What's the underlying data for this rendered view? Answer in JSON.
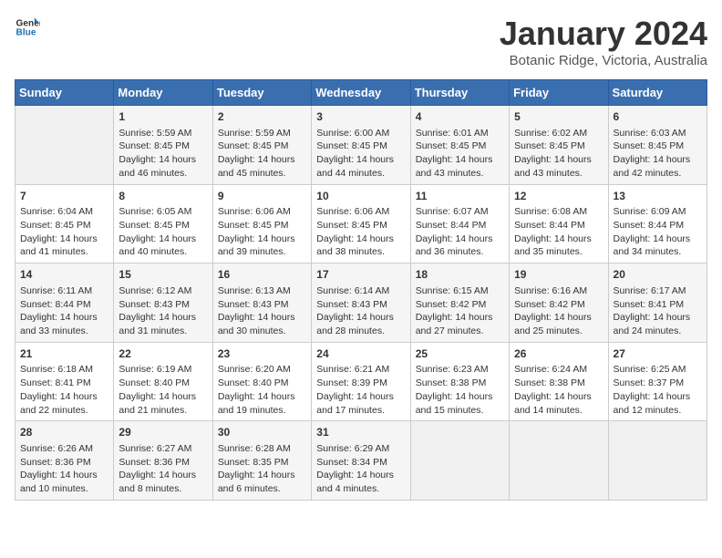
{
  "logo": {
    "line1": "General",
    "line2": "Blue"
  },
  "title": "January 2024",
  "subtitle": "Botanic Ridge, Victoria, Australia",
  "days_of_week": [
    "Sunday",
    "Monday",
    "Tuesday",
    "Wednesday",
    "Thursday",
    "Friday",
    "Saturday"
  ],
  "weeks": [
    [
      {
        "day": "",
        "info": ""
      },
      {
        "day": "1",
        "info": "Sunrise: 5:59 AM\nSunset: 8:45 PM\nDaylight: 14 hours\nand 46 minutes."
      },
      {
        "day": "2",
        "info": "Sunrise: 5:59 AM\nSunset: 8:45 PM\nDaylight: 14 hours\nand 45 minutes."
      },
      {
        "day": "3",
        "info": "Sunrise: 6:00 AM\nSunset: 8:45 PM\nDaylight: 14 hours\nand 44 minutes."
      },
      {
        "day": "4",
        "info": "Sunrise: 6:01 AM\nSunset: 8:45 PM\nDaylight: 14 hours\nand 43 minutes."
      },
      {
        "day": "5",
        "info": "Sunrise: 6:02 AM\nSunset: 8:45 PM\nDaylight: 14 hours\nand 43 minutes."
      },
      {
        "day": "6",
        "info": "Sunrise: 6:03 AM\nSunset: 8:45 PM\nDaylight: 14 hours\nand 42 minutes."
      }
    ],
    [
      {
        "day": "7",
        "info": "Sunrise: 6:04 AM\nSunset: 8:45 PM\nDaylight: 14 hours\nand 41 minutes."
      },
      {
        "day": "8",
        "info": "Sunrise: 6:05 AM\nSunset: 8:45 PM\nDaylight: 14 hours\nand 40 minutes."
      },
      {
        "day": "9",
        "info": "Sunrise: 6:06 AM\nSunset: 8:45 PM\nDaylight: 14 hours\nand 39 minutes."
      },
      {
        "day": "10",
        "info": "Sunrise: 6:06 AM\nSunset: 8:45 PM\nDaylight: 14 hours\nand 38 minutes."
      },
      {
        "day": "11",
        "info": "Sunrise: 6:07 AM\nSunset: 8:44 PM\nDaylight: 14 hours\nand 36 minutes."
      },
      {
        "day": "12",
        "info": "Sunrise: 6:08 AM\nSunset: 8:44 PM\nDaylight: 14 hours\nand 35 minutes."
      },
      {
        "day": "13",
        "info": "Sunrise: 6:09 AM\nSunset: 8:44 PM\nDaylight: 14 hours\nand 34 minutes."
      }
    ],
    [
      {
        "day": "14",
        "info": "Sunrise: 6:11 AM\nSunset: 8:44 PM\nDaylight: 14 hours\nand 33 minutes."
      },
      {
        "day": "15",
        "info": "Sunrise: 6:12 AM\nSunset: 8:43 PM\nDaylight: 14 hours\nand 31 minutes."
      },
      {
        "day": "16",
        "info": "Sunrise: 6:13 AM\nSunset: 8:43 PM\nDaylight: 14 hours\nand 30 minutes."
      },
      {
        "day": "17",
        "info": "Sunrise: 6:14 AM\nSunset: 8:43 PM\nDaylight: 14 hours\nand 28 minutes."
      },
      {
        "day": "18",
        "info": "Sunrise: 6:15 AM\nSunset: 8:42 PM\nDaylight: 14 hours\nand 27 minutes."
      },
      {
        "day": "19",
        "info": "Sunrise: 6:16 AM\nSunset: 8:42 PM\nDaylight: 14 hours\nand 25 minutes."
      },
      {
        "day": "20",
        "info": "Sunrise: 6:17 AM\nSunset: 8:41 PM\nDaylight: 14 hours\nand 24 minutes."
      }
    ],
    [
      {
        "day": "21",
        "info": "Sunrise: 6:18 AM\nSunset: 8:41 PM\nDaylight: 14 hours\nand 22 minutes."
      },
      {
        "day": "22",
        "info": "Sunrise: 6:19 AM\nSunset: 8:40 PM\nDaylight: 14 hours\nand 21 minutes."
      },
      {
        "day": "23",
        "info": "Sunrise: 6:20 AM\nSunset: 8:40 PM\nDaylight: 14 hours\nand 19 minutes."
      },
      {
        "day": "24",
        "info": "Sunrise: 6:21 AM\nSunset: 8:39 PM\nDaylight: 14 hours\nand 17 minutes."
      },
      {
        "day": "25",
        "info": "Sunrise: 6:23 AM\nSunset: 8:38 PM\nDaylight: 14 hours\nand 15 minutes."
      },
      {
        "day": "26",
        "info": "Sunrise: 6:24 AM\nSunset: 8:38 PM\nDaylight: 14 hours\nand 14 minutes."
      },
      {
        "day": "27",
        "info": "Sunrise: 6:25 AM\nSunset: 8:37 PM\nDaylight: 14 hours\nand 12 minutes."
      }
    ],
    [
      {
        "day": "28",
        "info": "Sunrise: 6:26 AM\nSunset: 8:36 PM\nDaylight: 14 hours\nand 10 minutes."
      },
      {
        "day": "29",
        "info": "Sunrise: 6:27 AM\nSunset: 8:36 PM\nDaylight: 14 hours\nand 8 minutes."
      },
      {
        "day": "30",
        "info": "Sunrise: 6:28 AM\nSunset: 8:35 PM\nDaylight: 14 hours\nand 6 minutes."
      },
      {
        "day": "31",
        "info": "Sunrise: 6:29 AM\nSunset: 8:34 PM\nDaylight: 14 hours\nand 4 minutes."
      },
      {
        "day": "",
        "info": ""
      },
      {
        "day": "",
        "info": ""
      },
      {
        "day": "",
        "info": ""
      }
    ]
  ]
}
